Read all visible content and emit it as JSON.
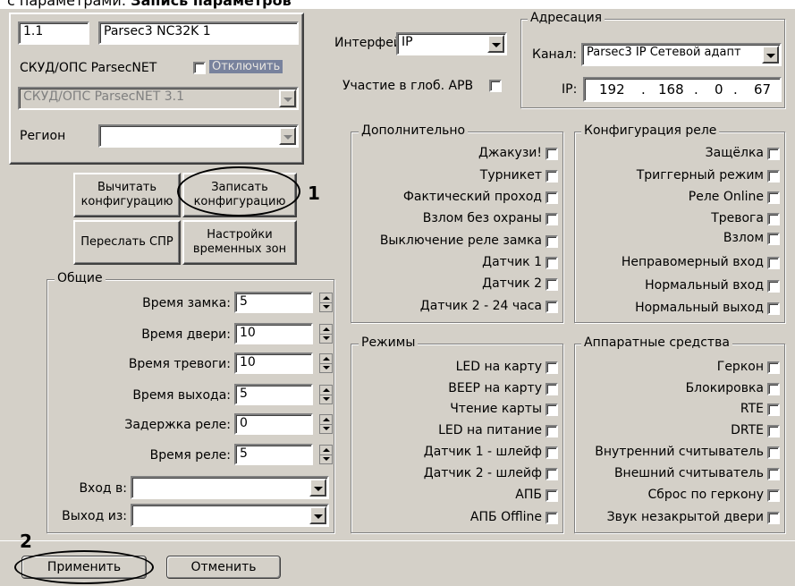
{
  "page_heading": {
    "prefix": "с параметрами:",
    "bold": "Запись параметров"
  },
  "device": {
    "address": "1.1",
    "name": "Parsec3 NC32K 1",
    "parent_label": "СКУД/ОПС ParsecNET",
    "disable_label": "Отключить",
    "parent_value": "СКУД/ОПС ParsecNET 3.1",
    "region_label": "Регион",
    "region_value": ""
  },
  "interface": {
    "label": "Интерфейс:",
    "value": "IP"
  },
  "global_apb": {
    "label": "Участие в глоб. APB"
  },
  "addressing": {
    "title": "Адресация",
    "channel_label": "Канал:",
    "channel_value": "Parsec3 IP Сетевой адапт",
    "ip_label": "IP:",
    "ip": [
      "192",
      "168",
      "0",
      "67"
    ]
  },
  "buttons": {
    "read_config": "Вычитать конфигурацию",
    "write_config": "Записать конфигурацию",
    "send_spr": "Переслать СПР",
    "time_zones": "Настройки временных зон",
    "apply": "Применить",
    "cancel": "Отменить"
  },
  "callouts": {
    "one": "1",
    "two": "2"
  },
  "general": {
    "title": "Общие",
    "rows": [
      {
        "label": "Время замка:",
        "value": "5"
      },
      {
        "label": "Время двери:",
        "value": "10"
      },
      {
        "label": "Время тревоги:",
        "value": "10"
      },
      {
        "label": "Время выхода:",
        "value": "5"
      },
      {
        "label": "Задержка реле:",
        "value": "0"
      },
      {
        "label": "Время реле:",
        "value": "5"
      }
    ],
    "entry_label": "Вход в:",
    "exit_label": "Выход из:"
  },
  "additional": {
    "title": "Дополнительно",
    "items": [
      "Джакузи!",
      "Турникет",
      "Фактический проход",
      "Взлом без охраны",
      "Выключение реле замка",
      "Датчик 1",
      "Датчик 2",
      "Датчик 2 - 24 часа"
    ]
  },
  "relay": {
    "title": "Конфигурация реле",
    "items": [
      "Защёлка",
      "Триггерный режим",
      "Реле Online",
      "Тревога",
      "Взлом",
      "Неправомерный вход",
      "Нормальный вход",
      "Нормальный выход"
    ]
  },
  "modes": {
    "title": "Режимы",
    "items": [
      "LED на карту",
      "BEEP на карту",
      "Чтение карты",
      "LED на питание",
      "Датчик 1 - шлейф",
      "Датчик 2 - шлейф",
      "АПБ",
      "АПБ Offline"
    ]
  },
  "hardware": {
    "title": "Аппаратные средства",
    "items": [
      "Геркон",
      "Блокировка",
      "RTE",
      "DRTE",
      "Внутренний считыватель",
      "Внешний считыватель",
      "Сброс по геркону",
      "Звук незакрытой двери"
    ]
  }
}
